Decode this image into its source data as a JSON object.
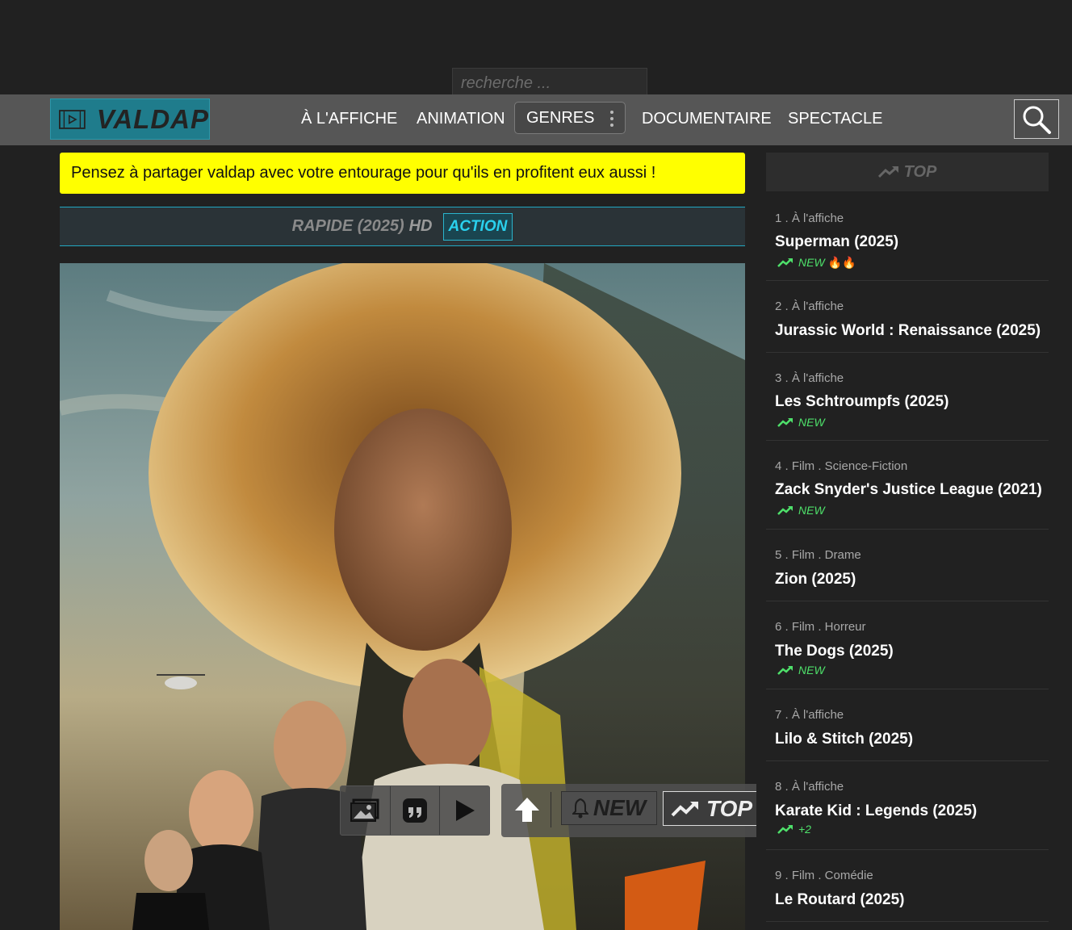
{
  "search": {
    "placeholder": "recherche ..."
  },
  "logo": {
    "text": "VALDAP"
  },
  "nav": {
    "items": [
      "À L'AFFICHE",
      "ANIMATION",
      "GENRES",
      "DOCUMENTAIRE",
      "SPECTACLE"
    ]
  },
  "notice": {
    "text": "Pensez à partager valdap avec votre entourage pour qu'ils en profitent eux aussi !"
  },
  "movie": {
    "title": "RAPIDE (2025)",
    "quality": "HD",
    "genre": "ACTION"
  },
  "toolbar": {
    "new_label": "NEW",
    "top_label": "TOP"
  },
  "sidebar": {
    "title": "TOP",
    "items": [
      {
        "meta": "1 . À l'affiche",
        "title": "Superman (2025)",
        "badge": "NEW",
        "flames": "🔥🔥"
      },
      {
        "meta": "2 . À l'affiche",
        "title": "Jurassic World : Renaissance (2025)",
        "badge": "",
        "flames": ""
      },
      {
        "meta": "3 . À l'affiche",
        "title": "Les Schtroumpfs (2025)",
        "badge": "NEW",
        "flames": ""
      },
      {
        "meta": "4 . Film . Science-Fiction",
        "title": "Zack Snyder's Justice League (2021)",
        "badge": "NEW",
        "flames": ""
      },
      {
        "meta": "5 . Film . Drame",
        "title": "Zion (2025)",
        "badge": "",
        "flames": ""
      },
      {
        "meta": "6 . Film . Horreur",
        "title": "The Dogs (2025)",
        "badge": "NEW",
        "flames": ""
      },
      {
        "meta": "7 . À l'affiche",
        "title": "Lilo & Stitch (2025)",
        "badge": "",
        "flames": ""
      },
      {
        "meta": "8 . À l'affiche",
        "title": "Karate Kid : Legends (2025)",
        "badge": "+2",
        "flames": ""
      },
      {
        "meta": "9 . Film . Comédie",
        "title": "Le Routard (2025)",
        "badge": "",
        "flames": ""
      }
    ]
  },
  "colors": {
    "accent": "#1f7c8c",
    "notice_bg": "#ffff00",
    "new_green": "#4ee06a",
    "genre_tag": "#2ad1ee"
  },
  "icons": [
    "film-icon",
    "search-icon",
    "image-icon",
    "quote-icon",
    "play-icon",
    "arrow-up-icon",
    "bell-icon",
    "trending-up-icon",
    "flame-icon"
  ]
}
